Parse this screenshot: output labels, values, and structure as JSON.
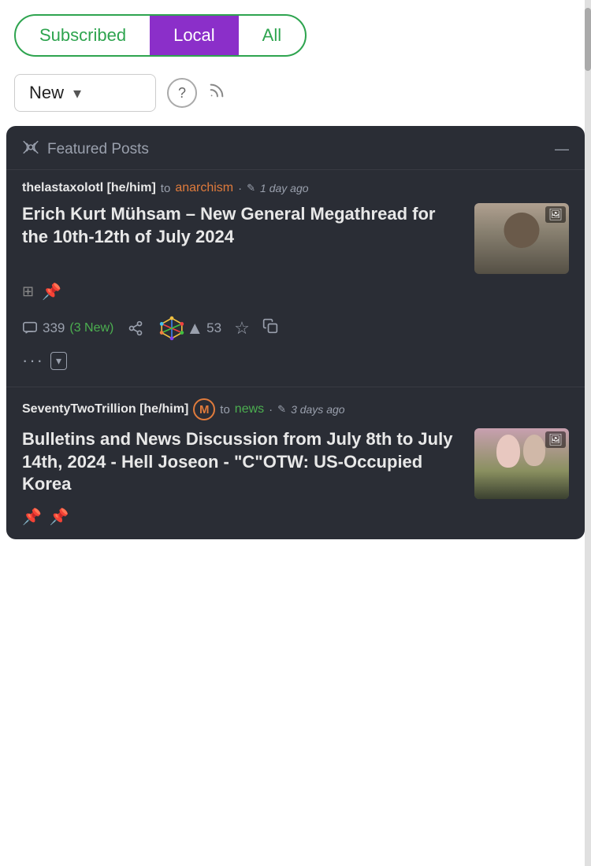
{
  "tabs": {
    "items": [
      {
        "label": "Subscribed",
        "active": false
      },
      {
        "label": "Local",
        "active": true
      },
      {
        "label": "All",
        "active": false
      }
    ]
  },
  "filter": {
    "sort_label": "New",
    "help_tooltip": "Help",
    "rss_label": "RSS"
  },
  "featured": {
    "label": "Featured Posts"
  },
  "posts": [
    {
      "author": "thelastaxolotl [he/him]",
      "to": "to",
      "community": "anarchism",
      "dot": "·",
      "edited_icon": "✎",
      "time": "1 day ago",
      "title": "Erich Kurt Mühsam – New General Megathread for the 10th-12th of July 2024",
      "comments_count": "339",
      "new_comments": "(3 New)",
      "vote_count": "53",
      "has_thumbnail": true,
      "thumbnail_type": "person"
    },
    {
      "author": "SeventyTwoTrillion [he/him]",
      "mod_badge": "M",
      "to": "to",
      "community": "news",
      "dot": "·",
      "edited_icon": "✎",
      "time": "3 days ago",
      "title": "Bulletins and News Discussion from July 8th to July 14th, 2024 - Hell Joseon - \"C\"OTW: US-Occupied Korea",
      "has_thumbnail": true,
      "thumbnail_type": "balloon"
    }
  ]
}
